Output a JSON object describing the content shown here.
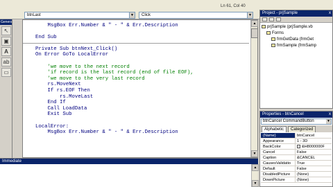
{
  "toolbar": {
    "object_combo": "btnLast",
    "procedure_combo": "Click",
    "cursor_position": "Ln 61, Col 40"
  },
  "toolbox": {
    "title": "General",
    "tools": [
      "pointer-icon",
      "picture-icon",
      "label-icon",
      "textbox-icon",
      "frame-icon"
    ]
  },
  "code": {
    "lines": [
      {
        "text": "    MsgBox Err.Number & \" - \" & Err.Description",
        "kind": "code"
      },
      {
        "text": "",
        "kind": "code"
      },
      {
        "text": "End Sub",
        "kind": "code"
      },
      {
        "text": "",
        "kind": "sep"
      },
      {
        "text": "Private Sub btnNext_Click()",
        "kind": "code"
      },
      {
        "text": "On Error GoTo LocalError",
        "kind": "code"
      },
      {
        "text": "",
        "kind": "code"
      },
      {
        "text": "    'we move to the next record",
        "kind": "cm"
      },
      {
        "text": "    'if record is the last record (end of file EOF),",
        "kind": "cm"
      },
      {
        "text": "    'we move to the very last record",
        "kind": "cm"
      },
      {
        "text": "    rs.MoveNext",
        "kind": "code"
      },
      {
        "text": "    If rs.EOF Then",
        "kind": "code"
      },
      {
        "text": "        rs.MoveLast",
        "kind": "code"
      },
      {
        "text": "    End If",
        "kind": "code"
      },
      {
        "text": "    Call LoadData",
        "kind": "code"
      },
      {
        "text": "    Exit Sub",
        "kind": "code"
      },
      {
        "text": "",
        "kind": "code"
      },
      {
        "text": "LocalError:",
        "kind": "code"
      },
      {
        "text": "    MsgBox Err.Number & \" - \" & Err.Description",
        "kind": "code"
      }
    ]
  },
  "immediate": {
    "title": "Immediate"
  },
  "project": {
    "title": "Project - prjSample",
    "close": "x",
    "tree": [
      {
        "label": "prjSample (prjSample.vb",
        "indent": 0
      },
      {
        "label": "Forms",
        "indent": 1
      },
      {
        "label": "frmGetData (frmGet",
        "indent": 2
      },
      {
        "label": "frmSample (frmSamp",
        "indent": 2
      }
    ]
  },
  "properties": {
    "title": "Properties - btnCancel",
    "close": "x",
    "object_selector": "btnCancel  CommandButton",
    "tabs": [
      "Alphabetic",
      "Categorized"
    ],
    "rows": [
      {
        "name": "(Name)",
        "value": "btnCancel",
        "selected": true
      },
      {
        "name": "Appearance",
        "value": "1 - 3D"
      },
      {
        "name": "BackColor",
        "value": "&H8000000F",
        "swatch": true
      },
      {
        "name": "Cancel",
        "value": "False"
      },
      {
        "name": "Caption",
        "value": "&CANCEL"
      },
      {
        "name": "CausesValidatio",
        "value": "True"
      },
      {
        "name": "Default",
        "value": "False"
      },
      {
        "name": "DisabledPicture",
        "value": "(None)"
      },
      {
        "name": "DownPicture",
        "value": "(None)"
      }
    ]
  },
  "colors": {
    "title_bar": "#0a246a",
    "keyword": "#00007f",
    "comment": "#007f00"
  }
}
